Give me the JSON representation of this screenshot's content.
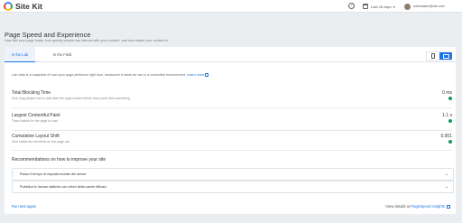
{
  "header": {
    "app_name": "Site Kit",
    "help_icon": "help-icon",
    "date_range": "Last 28 days",
    "account": "webmaster@site.com"
  },
  "section": {
    "title": "Page Speed and Experience",
    "subtitle": "How fast your page loads, how quickly people can interact with your content, and how stable your content is"
  },
  "tabs": {
    "lab": "In the Lab",
    "field": "In the Field"
  },
  "device_toggle": {
    "mobile_icon": "phone-icon",
    "desktop_icon": "monitor-icon",
    "selected": "desktop"
  },
  "intro": {
    "text": "Lab data is a snapshot of how your page performs right now, measured in tests we ran in a controlled environment.",
    "link": "Learn more"
  },
  "metrics": [
    {
      "name": "Total Blocking Time",
      "desc": "How long people had to wait after the page loaded before they could click something",
      "value": "0 ms"
    },
    {
      "name": "Largest Contentful Paint",
      "desc": "Time it takes for the page to load",
      "value": "1.1 s"
    },
    {
      "name": "Cumulative Layout Shift",
      "desc": "How stable the elements on the page are",
      "value": "0.001"
    }
  ],
  "recommendations": {
    "title": "Recommendations on how to improve your site",
    "items": [
      "Riduci il tempo di risposta iniziale del server",
      "Pubblica le risorse statiche con criteri della cache efficaci"
    ]
  },
  "footer": {
    "run_test": "Run test again",
    "view_details_prefix": "View details at",
    "view_details_link": "PageSpeed Insights"
  },
  "colors": {
    "accent": "#1a73e8",
    "status_good": "#0f9d58",
    "background": "#ebeef0"
  }
}
